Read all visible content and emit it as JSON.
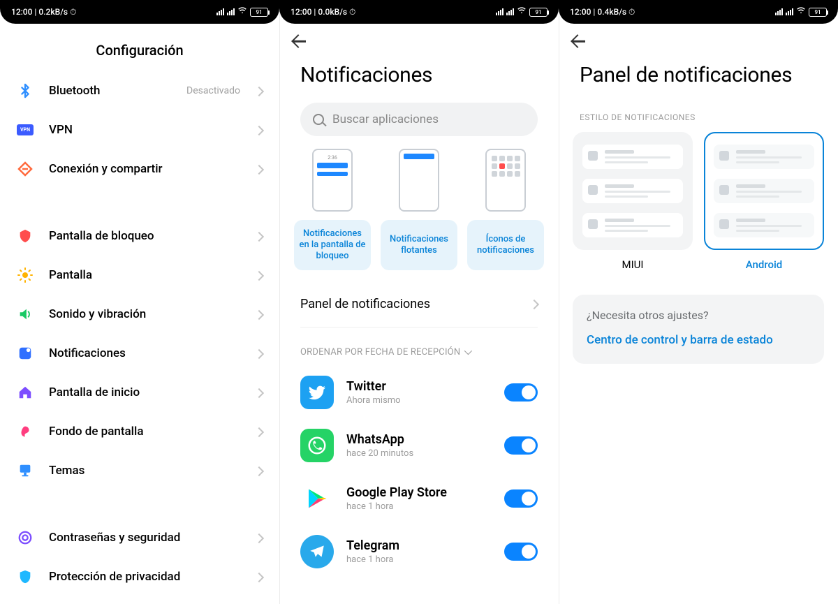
{
  "statusbar": {
    "left_a": "12:00 | 0.2kB/s ⏱",
    "left_b": "12:00 | 0.0kB/s ⏱",
    "left_c": "12:00 | 0.4kB/s ⏱",
    "battery": "91"
  },
  "screen1": {
    "title": "Configuración",
    "items": [
      {
        "icon": "bluetooth",
        "label": "Bluetooth",
        "status": "Desactivado",
        "color": "#2f8fff"
      },
      {
        "icon": "vpn",
        "label": "VPN",
        "status": "",
        "color": "#3b5bff"
      },
      {
        "icon": "share",
        "label": "Conexión y compartir",
        "status": "",
        "color": "#ff6a3d"
      }
    ],
    "items2": [
      {
        "icon": "lock",
        "label": "Pantalla de bloqueo",
        "color": "#ff4d4d"
      },
      {
        "icon": "sun",
        "label": "Pantalla",
        "color": "#ffb300"
      },
      {
        "icon": "sound",
        "label": "Sonido y vibración",
        "color": "#18c964"
      },
      {
        "icon": "notif",
        "label": "Notificaciones",
        "color": "#2f6fff"
      },
      {
        "icon": "home",
        "label": "Pantalla de inicio",
        "color": "#7c4dff"
      },
      {
        "icon": "wall",
        "label": "Fondo de pantalla",
        "color": "#ff3d7f"
      },
      {
        "icon": "theme",
        "label": "Temas",
        "color": "#2f8fff"
      }
    ],
    "items3": [
      {
        "icon": "key",
        "label": "Contraseñas y seguridad",
        "color": "#7c4dff"
      },
      {
        "icon": "shield",
        "label": "Protección de privacidad",
        "color": "#1eb8ff"
      }
    ]
  },
  "screen2": {
    "title": "Notificaciones",
    "search_placeholder": "Buscar aplicaciones",
    "styles": [
      {
        "label": "Notificaciones en la pantalla de bloqueo",
        "kind": "lock"
      },
      {
        "label": "Notificaciones flotantes",
        "kind": "float"
      },
      {
        "label": "Íconos de notificaciones",
        "kind": "icons"
      }
    ],
    "panel_label": "Panel de notificaciones",
    "sort_label": "ORDENAR POR FECHA DE RECEPCIÓN",
    "apps": [
      {
        "name": "Twitter",
        "time": "Ahora mismo",
        "kind": "twitter"
      },
      {
        "name": "WhatsApp",
        "time": "hace 20 minutos",
        "kind": "whatsapp"
      },
      {
        "name": "Google Play Store",
        "time": "hace 1 hora",
        "kind": "play"
      },
      {
        "name": "Telegram",
        "time": "hace 1 hora",
        "kind": "telegram"
      }
    ]
  },
  "screen3": {
    "title": "Panel de notificaciones",
    "section": "ESTILO DE NOTIFICACIONES",
    "styles": [
      {
        "label": "MIUI",
        "selected": false
      },
      {
        "label": "Android",
        "selected": true
      }
    ],
    "help_q": "¿Necesita otros ajustes?",
    "help_link": "Centro de control y barra de estado"
  }
}
